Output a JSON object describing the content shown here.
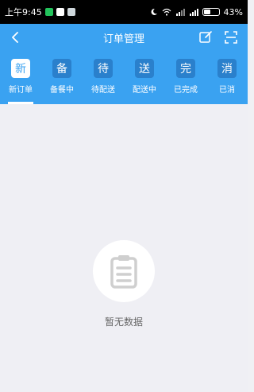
{
  "status_bar": {
    "time": "上午9:45",
    "battery": "43%"
  },
  "header": {
    "title": "订单管理"
  },
  "tabs": [
    {
      "icon_char": "新",
      "label": "新订单",
      "active": true
    },
    {
      "icon_char": "备",
      "label": "备餐中",
      "active": false
    },
    {
      "icon_char": "待",
      "label": "待配送",
      "active": false
    },
    {
      "icon_char": "送",
      "label": "配送中",
      "active": false
    },
    {
      "icon_char": "完",
      "label": "已完成",
      "active": false
    },
    {
      "icon_char": "消",
      "label": "已消",
      "active": false
    }
  ],
  "empty_state": {
    "text": "暂无数据",
    "icon": "clipboard-icon"
  },
  "colors": {
    "primary": "#3aa2f1",
    "tab_box": "#2a80cc",
    "background": "#efeff4"
  }
}
